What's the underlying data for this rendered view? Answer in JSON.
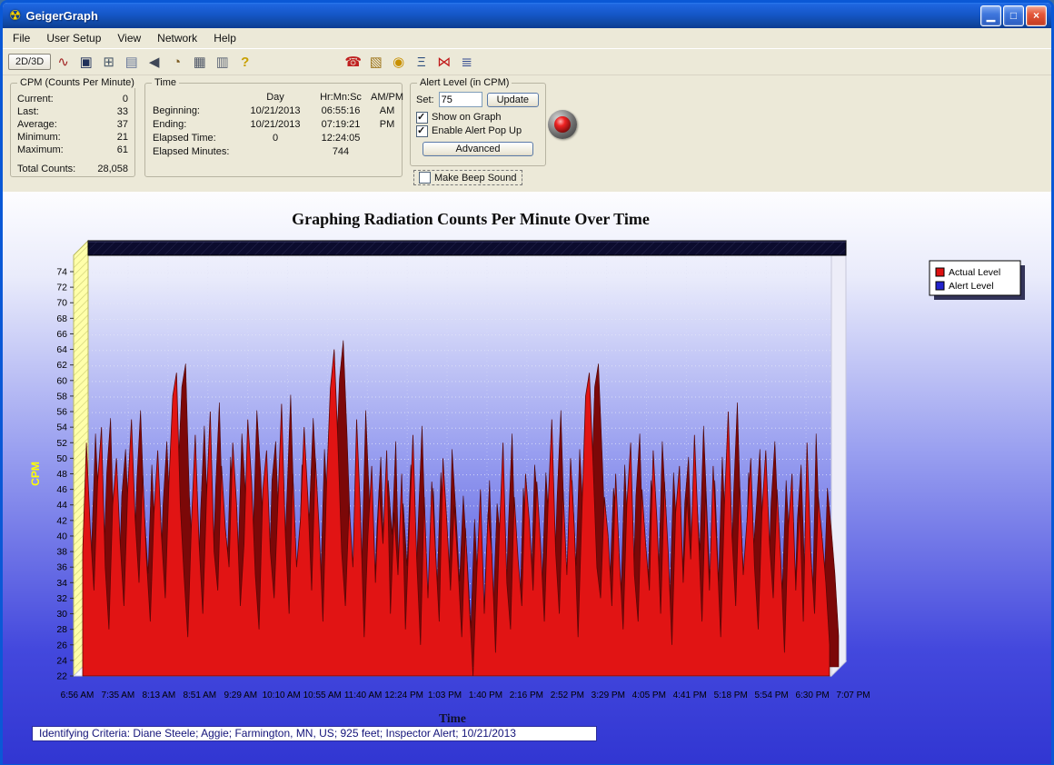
{
  "window": {
    "title": "GeigerGraph",
    "controls": {
      "minimize": "▁",
      "maximize": "□",
      "close": "×"
    }
  },
  "menu": {
    "items": [
      "File",
      "User Setup",
      "View",
      "Network",
      "Help"
    ]
  },
  "toolbar": {
    "mode_button": "2D/3D",
    "icons_left": [
      {
        "name": "waveform-icon",
        "glyph": "∿"
      },
      {
        "name": "save-icon",
        "glyph": "▣"
      },
      {
        "name": "calculator-icon",
        "glyph": "⊞"
      },
      {
        "name": "report-icon",
        "glyph": "▤"
      },
      {
        "name": "speaker-icon",
        "glyph": "◀"
      },
      {
        "name": "clock-icon",
        "glyph": "◔"
      },
      {
        "name": "printer-icon",
        "glyph": "▦"
      },
      {
        "name": "tape-icon",
        "glyph": "▥"
      },
      {
        "name": "help-icon",
        "glyph": "?"
      }
    ],
    "icons_right": [
      {
        "name": "phone-icon",
        "glyph": "☎"
      },
      {
        "name": "calendar-icon",
        "glyph": "▧"
      },
      {
        "name": "bell-icon",
        "glyph": "◉"
      },
      {
        "name": "scales-icon",
        "glyph": "Ξ"
      },
      {
        "name": "ribbon-icon",
        "glyph": "⋈"
      },
      {
        "name": "network-icon",
        "glyph": "≣"
      }
    ]
  },
  "cpm_panel": {
    "title": "CPM (Counts Per Minute)",
    "rows": [
      [
        "Current:",
        "0"
      ],
      [
        "Last:",
        "33"
      ],
      [
        "Average:",
        "37"
      ],
      [
        "Minimum:",
        "21"
      ],
      [
        "Maximum:",
        "61"
      ]
    ],
    "total_label": "Total Counts:",
    "total_value": "28,058"
  },
  "time_panel": {
    "title": "Time",
    "headers": [
      "Day",
      "Hr:Mn:Sc",
      "AM/PM"
    ],
    "rows": [
      [
        "Beginning:",
        "10/21/2013",
        "06:55:16",
        "AM"
      ],
      [
        "Ending:",
        "10/21/2013",
        "07:19:21",
        "PM"
      ],
      [
        "Elapsed Time:",
        "0",
        "12:24:05",
        ""
      ],
      [
        "Elapsed Minutes:",
        "",
        "744",
        ""
      ]
    ]
  },
  "alert_panel": {
    "title": "Alert Level (in CPM)",
    "set_label": "Set:",
    "set_value": "75",
    "update_button": "Update",
    "show_on_graph": {
      "label": "Show on Graph",
      "checked": true
    },
    "enable_popup": {
      "label": "Enable Alert Pop Up",
      "checked": true
    },
    "advanced_button": "Advanced",
    "beep": {
      "label": "Make Beep Sound",
      "checked": false
    }
  },
  "status": {
    "identifying_criteria": "Identifying Criteria:  Diane Steele;  Aggie;  Farmington, MN, US;  925 feet;  Inspector Alert;  10/21/2013"
  },
  "chart_data": {
    "type": "area",
    "title": "Graphing Radiation Counts Per Minute Over Time",
    "xlabel": "Time",
    "ylabel": "CPM",
    "ylim": [
      22,
      74
    ],
    "ytick_step": 2,
    "alert_level": 75,
    "grid": true,
    "legend_position": "top-right",
    "background": "blue-gradient",
    "legend": [
      {
        "label": "Actual Level",
        "color": "#dd1111"
      },
      {
        "label": "Alert Level",
        "color": "#2222cc"
      }
    ],
    "x_tick_labels": [
      "6:56 AM",
      "7:35 AM",
      "8:13 AM",
      "8:51 AM",
      "9:29 AM",
      "10:10 AM",
      "10:55 AM",
      "11:40 AM",
      "12:24 PM",
      "1:03 PM",
      "1:40 PM",
      "2:16 PM",
      "2:52 PM",
      "3:29 PM",
      "4:05 PM",
      "4:41 PM",
      "5:18 PM",
      "5:54 PM",
      "6:30 PM",
      "7:07 PM"
    ],
    "values": [
      38,
      52,
      41,
      33,
      47,
      54,
      36,
      28,
      44,
      50,
      39,
      31,
      46,
      55,
      42,
      34,
      48,
      37,
      29,
      43,
      51,
      40,
      32,
      47,
      58,
      61,
      44,
      35,
      27,
      42,
      53,
      39,
      30,
      45,
      56,
      38,
      33,
      49,
      41,
      36,
      52,
      44,
      31,
      39,
      55,
      47,
      35,
      28,
      46,
      51,
      38,
      32,
      44,
      57,
      40,
      30,
      48,
      36,
      42,
      54,
      45,
      33,
      50,
      41,
      29,
      47,
      59,
      64,
      52,
      38,
      31,
      44,
      36,
      55,
      43,
      27,
      40,
      49,
      34,
      46,
      39,
      51,
      30,
      43,
      35,
      48,
      28,
      41,
      53,
      37,
      26,
      45,
      32,
      47,
      38,
      29,
      50,
      42,
      33,
      44,
      36,
      27,
      41,
      31,
      22,
      35,
      46,
      30,
      43,
      38,
      25,
      40,
      52,
      34,
      28,
      45,
      37,
      31,
      48,
      42,
      33,
      47,
      39,
      29,
      44,
      55,
      38,
      30,
      46,
      35,
      50,
      41,
      27,
      43,
      58,
      61,
      49,
      36,
      32,
      45,
      40,
      31,
      48,
      37,
      28,
      44,
      52,
      35,
      29,
      46,
      39,
      33,
      51,
      42,
      30,
      47,
      38,
      26,
      43,
      49,
      34,
      45,
      37,
      53,
      41,
      29,
      46,
      33,
      49,
      38,
      27,
      44,
      56,
      40,
      31,
      47,
      35,
      42,
      50,
      36,
      28,
      43,
      51,
      39,
      32,
      46,
      37,
      25,
      41,
      48,
      33,
      44,
      29,
      52,
      38,
      30,
      45,
      40,
      34,
      26
    ]
  }
}
